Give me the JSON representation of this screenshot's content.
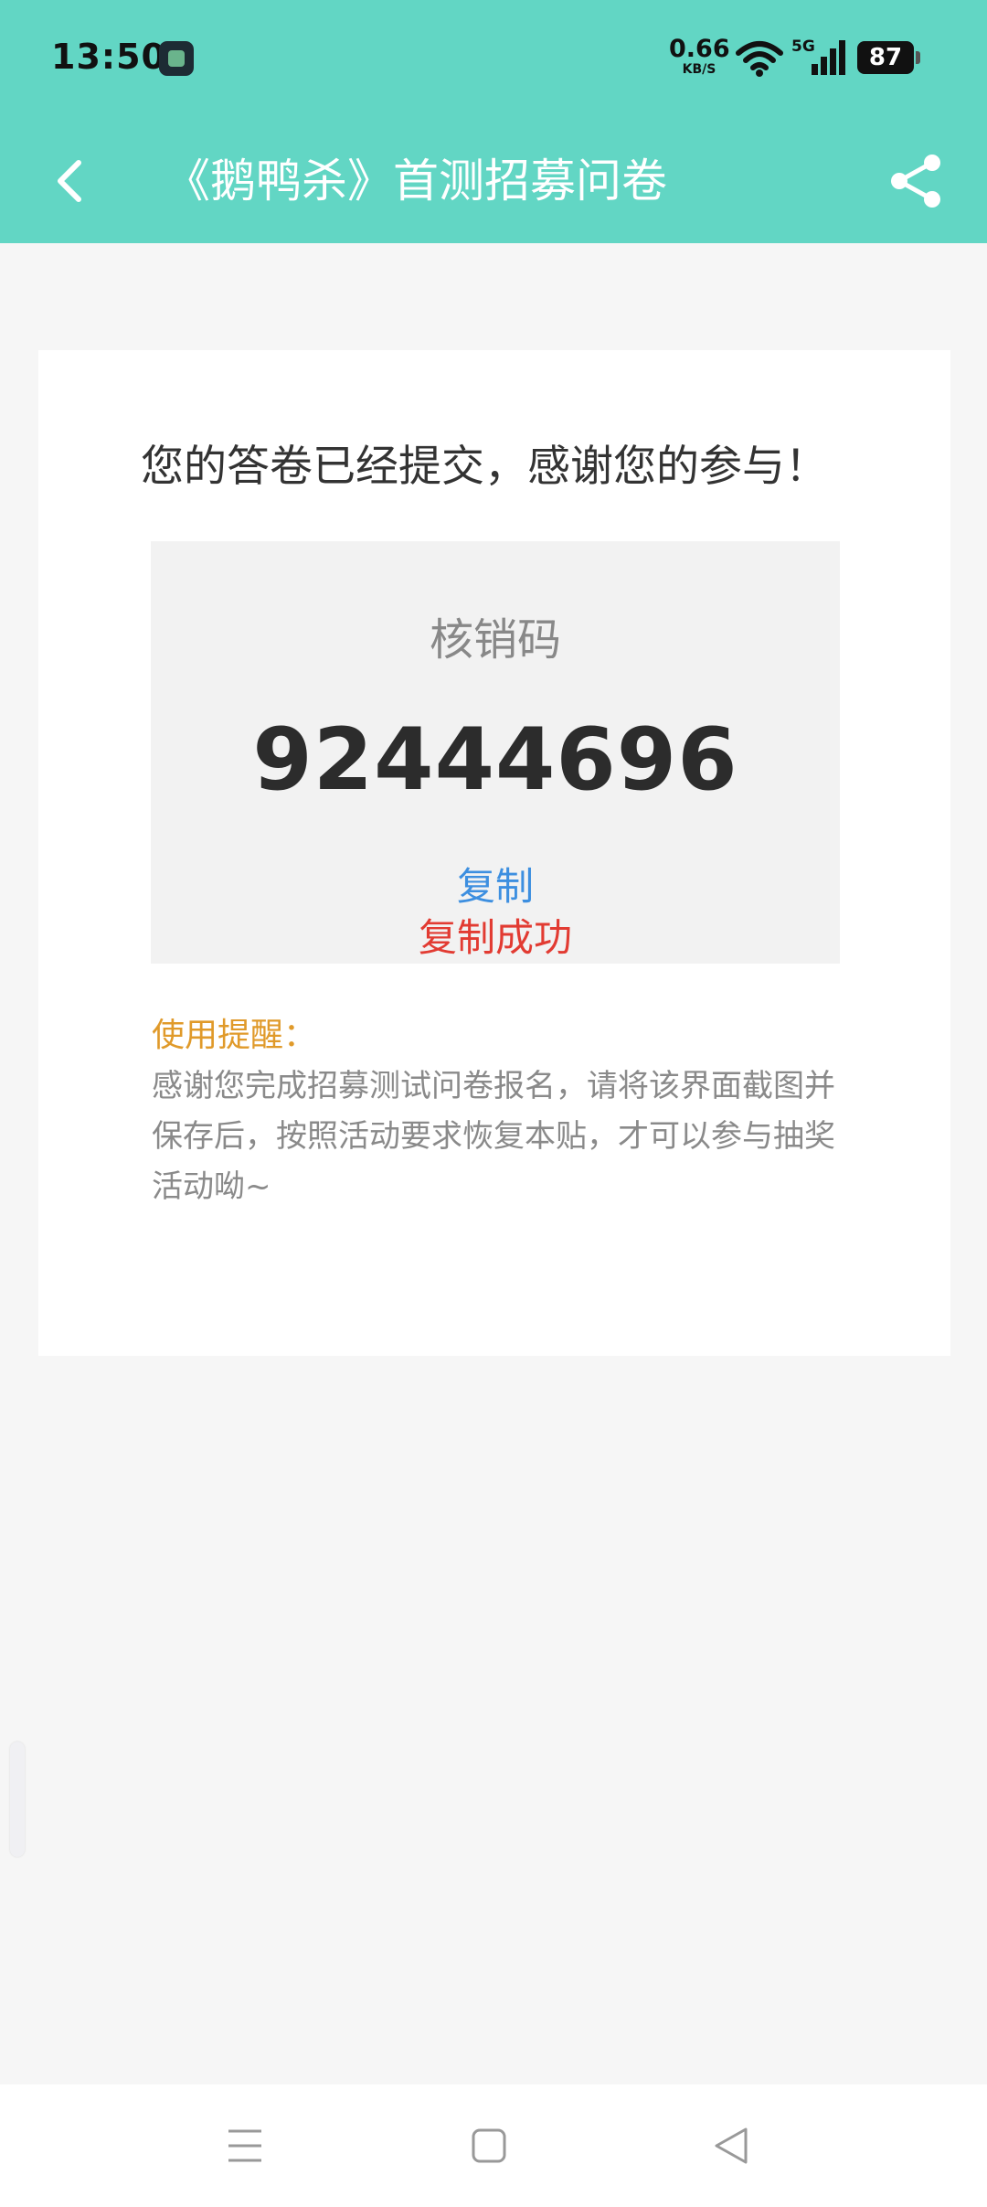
{
  "status_bar": {
    "time": "13:50",
    "net_speed": "0.66",
    "net_unit": "KB/S",
    "network_type": "5G",
    "battery": "87"
  },
  "app_bar": {
    "title": "《鹅鸭杀》首测招募问卷",
    "icons": [
      "back-icon",
      "share-icon"
    ]
  },
  "content": {
    "thanks_message": "您的答卷已经提交，感谢您的参与！",
    "code_label": "核销码",
    "code_value": "92444696",
    "copy_label": "复制",
    "copy_success_label": "复制成功",
    "tip_title": "使用提醒：",
    "tip_body": "感谢您完成招募测试问卷报名，请将该界面截图并保存后，按照活动要求恢复本贴，才可以参与抽奖活动呦~"
  },
  "colors": {
    "header": "#62d6c4",
    "link": "#3d8fe0",
    "success": "#e23b32",
    "tip_title": "#e09a2a"
  },
  "nav_bar": {
    "icons": [
      "menu-icon",
      "home-icon",
      "back-triangle-icon"
    ]
  }
}
